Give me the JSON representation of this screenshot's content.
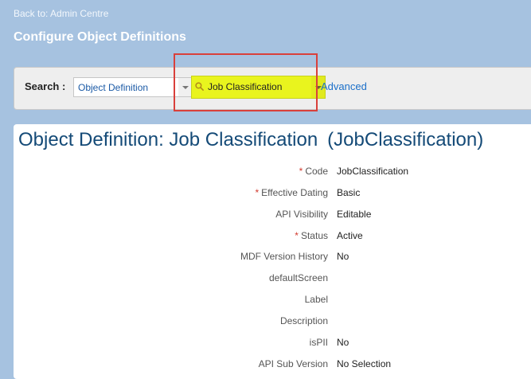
{
  "header": {
    "back_link": "Back to: Admin Centre",
    "page_title": "Configure Object Definitions"
  },
  "search": {
    "label": "Search :",
    "type_select": "Object Definition",
    "value_select": "Job Classification",
    "advanced_link": "Advanced",
    "highlight_color": "#e9f41e",
    "callout_color": "#d9403b"
  },
  "object": {
    "title_prefix": "Object Definition: Job Classification",
    "title_code": "(JobClassification)",
    "required_marker": "*",
    "fields": [
      {
        "label": "Code",
        "value": "JobClassification",
        "required": true
      },
      {
        "label": "Effective Dating",
        "value": "Basic",
        "required": true
      },
      {
        "label": "API Visibility",
        "value": "Editable",
        "required": false
      },
      {
        "label": "Status",
        "value": "Active",
        "required": true
      },
      {
        "label": "MDF Version History",
        "value": "No",
        "required": false
      },
      {
        "label": "defaultScreen",
        "value": "",
        "required": false
      },
      {
        "label": "Label",
        "value": "",
        "required": false
      },
      {
        "label": "Description",
        "value": "",
        "required": false
      },
      {
        "label": "isPII",
        "value": "No",
        "required": false
      },
      {
        "label": "API Sub Version",
        "value": "No Selection",
        "required": false
      }
    ]
  }
}
